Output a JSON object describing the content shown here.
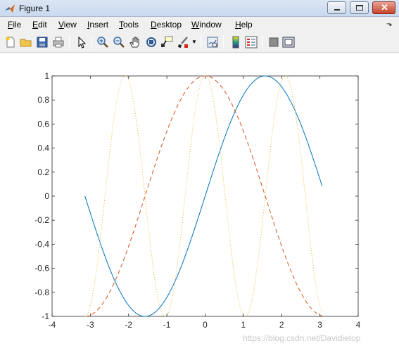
{
  "window": {
    "title": "Figure 1",
    "controls": [
      "minimize",
      "maximize",
      "close"
    ]
  },
  "menu": {
    "items": [
      {
        "label": "File",
        "u": "F",
        "rest": "ile"
      },
      {
        "label": "Edit",
        "u": "E",
        "rest": "dit"
      },
      {
        "label": "View",
        "u": "V",
        "rest": "iew"
      },
      {
        "label": "Insert",
        "u": "I",
        "rest": "nsert"
      },
      {
        "label": "Tools",
        "u": "T",
        "rest": "ools"
      },
      {
        "label": "Desktop",
        "u": "D",
        "rest": "esktop"
      },
      {
        "label": "Window",
        "u": "W",
        "rest": "indow"
      },
      {
        "label": "Help",
        "u": "H",
        "rest": "elp"
      }
    ]
  },
  "toolbar": {
    "icons": [
      "new-figure-icon",
      "open-file-icon",
      "save-icon",
      "print-icon",
      "edit-plot-arrow-icon",
      "zoom-in-icon",
      "zoom-out-icon",
      "pan-hand-icon",
      "rotate-3d-icon",
      "data-cursor-icon",
      "brush-icon",
      "link-plot-icon",
      "insert-colorbar-icon",
      "insert-legend-icon",
      "hide-plot-tools-icon",
      "show-plot-tools-icon"
    ]
  },
  "chart_data": {
    "type": "line",
    "xlim": [
      -4,
      4
    ],
    "ylim": [
      -1,
      1
    ],
    "xticks": [
      "-4",
      "-3",
      "-2",
      "-1",
      "0",
      "1",
      "2",
      "3",
      "4"
    ],
    "yticks": [
      "1",
      "0.8",
      "0.6",
      "0.4",
      "0.2",
      "0",
      "-0.2",
      "-0.4",
      "-0.6",
      "-0.8",
      "-1"
    ],
    "grid": false,
    "series": [
      {
        "function": "sin(x)",
        "style": "solid",
        "color": "#0072bd",
        "x_range": [
          -3.1416,
          3.0584
        ]
      },
      {
        "function": "cos(x)",
        "style": "dashed",
        "color": "#d95319",
        "x_range": [
          -3.1416,
          3.0584
        ]
      },
      {
        "function": "cos(3x)",
        "style": "dotted",
        "color": "#edb120",
        "x_range": [
          -3.1416,
          3.0584
        ]
      }
    ]
  },
  "watermark": "https://blog.csdn.net/Davidietop"
}
